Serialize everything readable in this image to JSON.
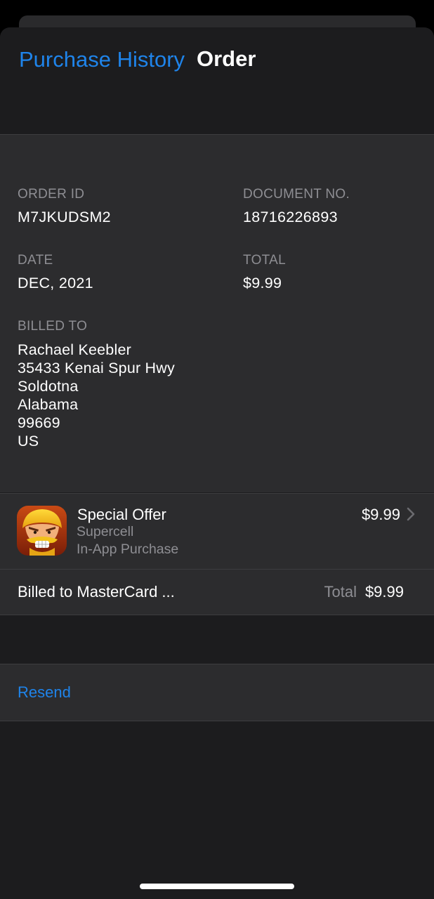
{
  "nav": {
    "back_label": "Purchase History",
    "title": "Order"
  },
  "order": {
    "order_id_label": "ORDER ID",
    "order_id": "M7JKUDSM2",
    "document_label": "DOCUMENT NO.",
    "document_no": "18716226893",
    "date_label": "DATE",
    "date": "DEC, 2021",
    "total_label": "TOTAL",
    "total": "$9.99",
    "billed_label": "BILLED TO",
    "address": [
      "Rachael Keebler",
      "35433 Kenai Spur Hwy",
      "Soldotna",
      "Alabama",
      "99669",
      "US"
    ]
  },
  "item": {
    "icon": "clash-of-clans-app-icon",
    "name": "Special Offer",
    "developer": "Supercell",
    "type": "In-App Purchase",
    "price": "$9.99"
  },
  "billing": {
    "billed_to": "Billed to MasterCard ...",
    "total_label": "Total",
    "total_value": "$9.99"
  },
  "actions": {
    "resend_label": "Resend"
  },
  "colors": {
    "accent": "#1f84ea",
    "background": "#1c1c1e",
    "card": "#2c2c2e",
    "secondary_text": "#8e8e93"
  }
}
